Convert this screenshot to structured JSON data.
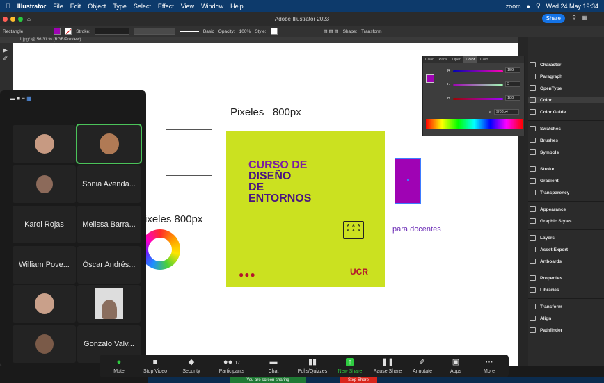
{
  "menubar": {
    "app": "Illustrator",
    "items": [
      "File",
      "Edit",
      "Object",
      "Type",
      "Select",
      "Effect",
      "View",
      "Window",
      "Help"
    ],
    "status_app": "zoom",
    "datetime": "Wed 24 May 19:34"
  },
  "titlebar": {
    "title": "Adobe Illustrator 2023",
    "share": "Share"
  },
  "controlbar": {
    "object": "Rectangle",
    "stroke_label": "Stroke:",
    "basic": "Basic",
    "opacity_label": "Opacity:",
    "opacity_value": "100%",
    "style_label": "Style:",
    "shape": "Shape:",
    "transform": "Transform"
  },
  "doc_tab": "1.jpg* @ 56,31 % (RGB/Preview)",
  "canvas": {
    "pixels_top": "Pixeles   800px",
    "pixels_left": "ixeles  800px",
    "card_line1": "CURSO DE",
    "card_line2": "DISEÑO",
    "card_line3": "DE",
    "card_line4": "ENTORNOS",
    "card_brand": "UCR",
    "para_docentes": "para docentes",
    "card_color": "#cbe120",
    "purple": "#9f03b4"
  },
  "color_panel": {
    "tabs": [
      "Char",
      "Para",
      "Oper",
      "Color",
      "Colo"
    ],
    "active_tab": "Color",
    "r_label": "R",
    "r_value": "159",
    "g_label": "G",
    "g_value": "3",
    "b_label": "B",
    "b_value": "180",
    "hex_label": "#",
    "hex": "9f03b4"
  },
  "dock": {
    "items": [
      "Character",
      "Paragraph",
      "OpenType",
      "Color",
      "Color Guide",
      "Swatches",
      "Brushes",
      "Symbols",
      "Stroke",
      "Gradient",
      "Transparency",
      "Appearance",
      "Graphic Styles",
      "Layers",
      "Asset Export",
      "Artboards",
      "Properties",
      "Libraries",
      "Transform",
      "Align",
      "Pathfinder"
    ]
  },
  "gallery": {
    "names": [
      "Sonia Avenda...",
      "Karol Rojas",
      "Melissa Barra...",
      "William Pove...",
      "Óscar Andrés...",
      "Gonzalo Valv..."
    ]
  },
  "zoombar": {
    "buttons": [
      "Mute",
      "Stop Video",
      "Security",
      "Participants",
      "Chat",
      "Polls/Quizzes",
      "New Share",
      "Pause Share",
      "Annotate",
      "Apps",
      "More"
    ],
    "participants_count": "17"
  },
  "sharing": {
    "notice": "You are screen sharing",
    "stop": "Stop Share"
  }
}
